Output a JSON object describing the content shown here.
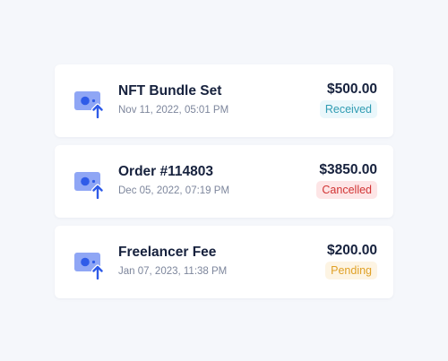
{
  "transactions": [
    {
      "icon": "money-upload-icon",
      "title": "NFT Bundle Set",
      "date": "Nov 11, 2022, 05:01 PM",
      "amount": "$500.00",
      "status": "Received",
      "status_type": "received"
    },
    {
      "icon": "money-upload-icon",
      "title": "Order #114803",
      "date": "Dec 05, 2022, 07:19 PM",
      "amount": "$3850.00",
      "status": "Cancelled",
      "status_type": "cancelled"
    },
    {
      "icon": "money-upload-icon",
      "title": "Freelancer Fee",
      "date": "Jan 07, 2023, 11:38 PM",
      "amount": "$200.00",
      "status": "Pending",
      "status_type": "pending"
    }
  ],
  "colors": {
    "background": "#f5f7fb",
    "card": "#ffffff",
    "icon_bill": "#8fa6f5",
    "icon_accent": "#2f5be8",
    "received": "#2f9bb2",
    "cancelled": "#d13434",
    "pending": "#e0a127"
  }
}
